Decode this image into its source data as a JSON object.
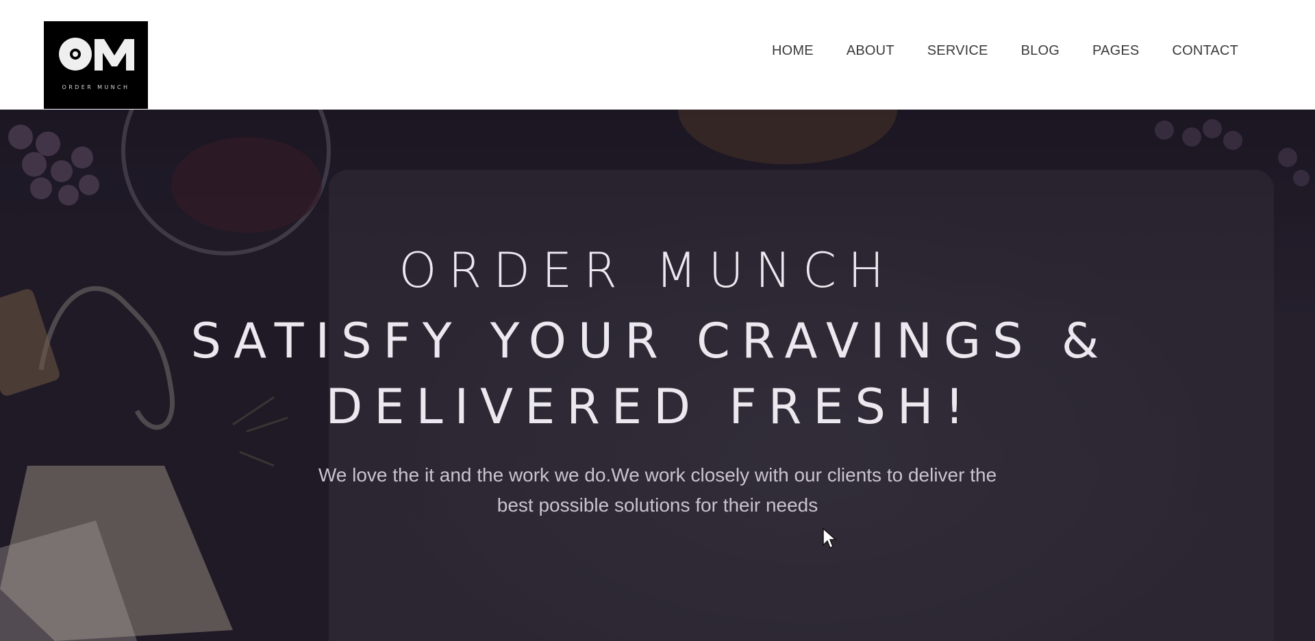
{
  "header": {
    "logo": {
      "letters": "OM",
      "tagline": "ORDER MUNCH"
    },
    "nav": [
      {
        "label": "HOME"
      },
      {
        "label": "ABOUT"
      },
      {
        "label": "SERVICE"
      },
      {
        "label": "BLOG"
      },
      {
        "label": "PAGES"
      },
      {
        "label": "CONTACT"
      }
    ]
  },
  "hero": {
    "brand": "ORDER MUNCH",
    "title": "SATISFY YOUR CRAVINGS & DELIVERED FRESH!",
    "subtitle": "We love the it and the work we do.We work closely with our clients to deliver the best possible solutions for their needs"
  },
  "colors": {
    "header_bg": "#ffffff",
    "nav_text": "#3a3a3a",
    "logo_bg": "#000000",
    "hero_text": "#ece8ef",
    "hero_bg": "#2a2431"
  }
}
